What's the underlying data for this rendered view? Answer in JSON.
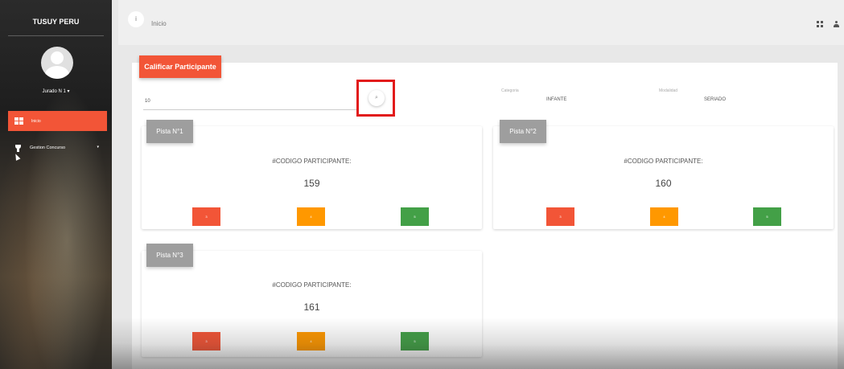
{
  "sidebar": {
    "brand": "TUSUY PERU",
    "user_label": "Jurado N 1 ▾",
    "nav": [
      {
        "label": "Inicio",
        "icon": "dashboard-icon",
        "active": true
      },
      {
        "label": "Gestion Concurso",
        "icon": "trophy-icon",
        "caret": "▾"
      }
    ]
  },
  "topbar": {
    "info_glyph": "i",
    "breadcrumb": "Inicio"
  },
  "main": {
    "header_button": "Calificar Participante",
    "search": {
      "value": "10",
      "icon": "search-icon",
      "glyph": "⌕"
    },
    "fields": {
      "categoria_label": "Categoria",
      "categoria_value": "INFANTE",
      "modalidad_label": "Modalidad",
      "modalidad_value": "SERIADO"
    },
    "cards": [
      {
        "title": "Pista N°1",
        "code_label": "#CODIGO PARTICIPANTE:",
        "code": "159",
        "buttons": [
          {
            "label": "3",
            "color": "#f25537"
          },
          {
            "label": "4",
            "color": "#ff9800"
          },
          {
            "label": "5",
            "color": "#43a047"
          }
        ]
      },
      {
        "title": "Pista N°2",
        "code_label": "#CODIGO PARTICIPANTE:",
        "code": "160",
        "buttons": [
          {
            "label": "3",
            "color": "#f25537"
          },
          {
            "label": "4",
            "color": "#ff9800"
          },
          {
            "label": "5",
            "color": "#43a047"
          }
        ]
      },
      {
        "title": "Pista N°3",
        "code_label": "#CODIGO PARTICIPANTE:",
        "code": "161",
        "buttons": [
          {
            "label": "3",
            "color": "#f25537"
          },
          {
            "label": "4",
            "color": "#ff9800"
          },
          {
            "label": "5",
            "color": "#43a047"
          }
        ]
      }
    ]
  },
  "colors": {
    "accent": "#f25537",
    "highlight": "#e21b1b",
    "card_tab": "#9e9e9e"
  }
}
